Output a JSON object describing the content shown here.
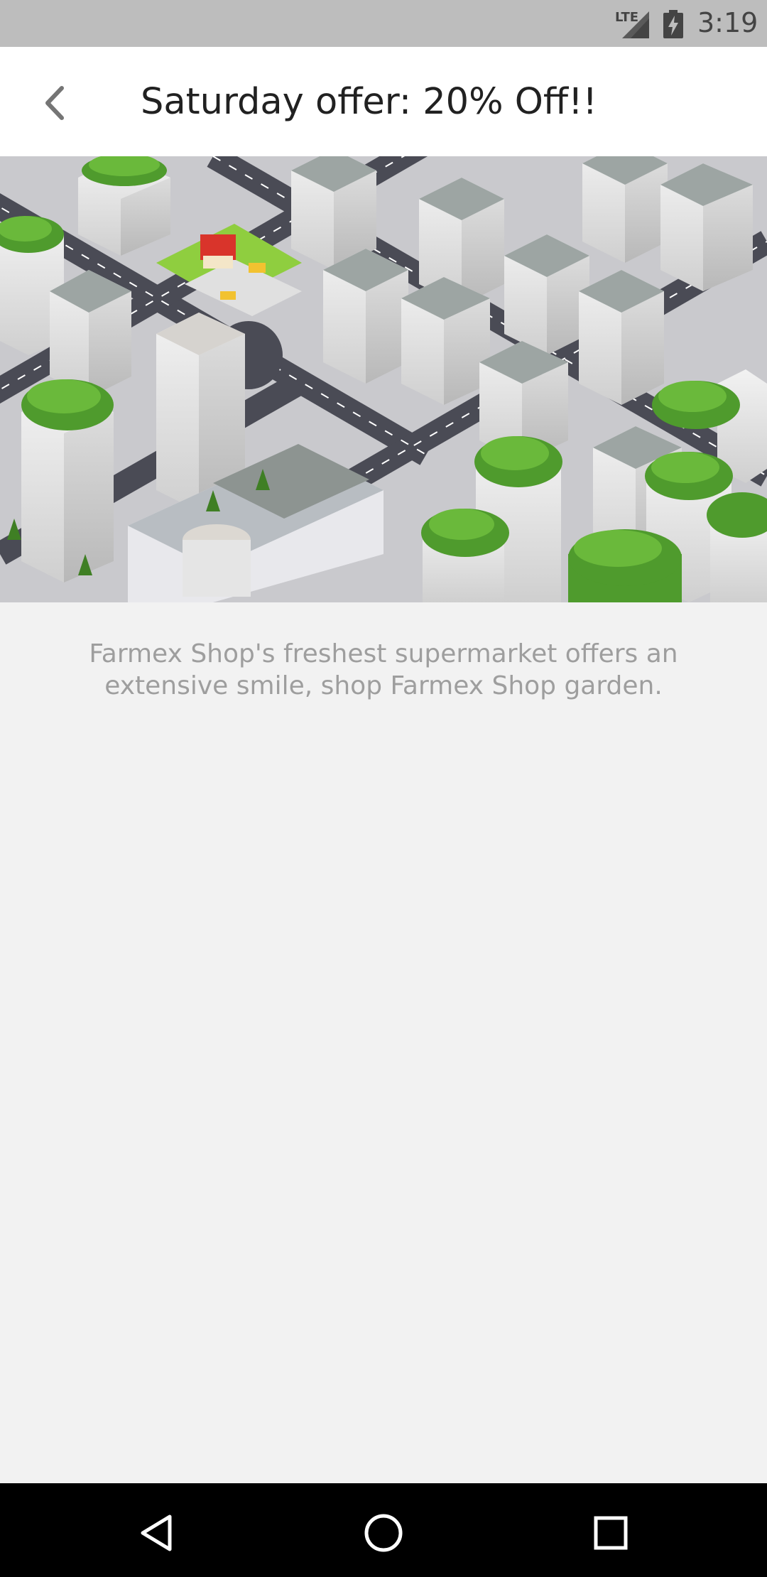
{
  "status_bar": {
    "network": "LTE",
    "time": "3:19"
  },
  "header": {
    "title": "Saturday offer: 20% Off!!",
    "back_icon": "chevron-left-icon"
  },
  "hero": {
    "image": "isometric-green-city-illustration"
  },
  "description": "Farmex Shop's freshest supermarket offers an extensive smile, shop Farmex Shop garden.",
  "nav_bar": {
    "back_icon": "triangle-back-icon",
    "home_icon": "circle-home-icon",
    "recents_icon": "square-recents-icon"
  }
}
